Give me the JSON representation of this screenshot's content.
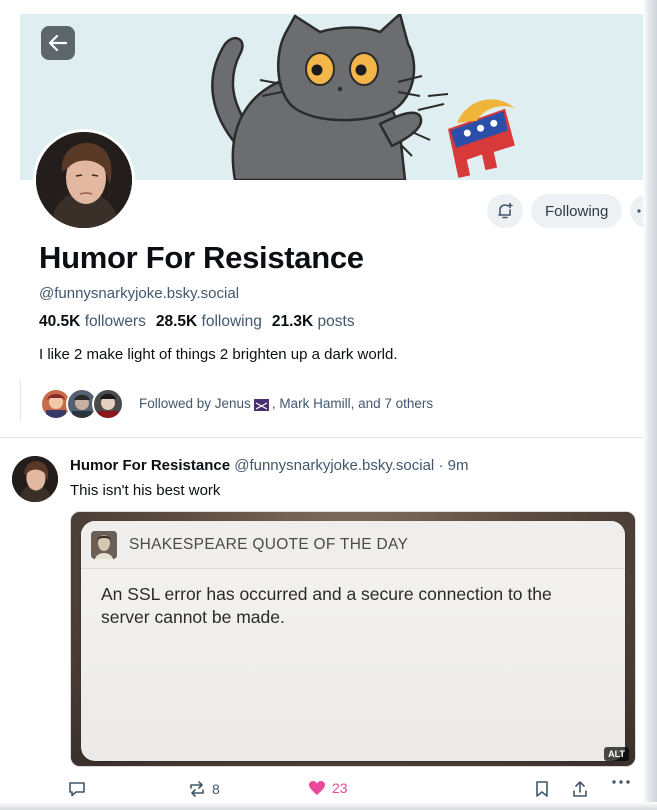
{
  "profile": {
    "display_name": "Humor For Resistance",
    "handle": "@funnysnarkyjoke.bsky.social",
    "bio": "I like 2 make light of things 2 brighten up a dark world.",
    "stats": {
      "followers_count": "40.5K",
      "followers_label": "followers",
      "following_count": "28.5K",
      "following_label": "following",
      "posts_count": "21.3K",
      "posts_label": "posts"
    },
    "following_button_label": "Following",
    "followed_by": {
      "prefix": "Followed by Jenus",
      "suffix": ", Mark Hamill, and 7 others"
    }
  },
  "post": {
    "author_name": "Humor For Resistance",
    "author_handle": "@funnysnarkyjoke.bsky.social",
    "separator": "·",
    "time": "9m",
    "text": "This isn't his best work",
    "image": {
      "card_title": "SHAKESPEARE QUOTE OF THE DAY",
      "card_body": "An SSL error has occurred and a secure connection to the server cannot be made.",
      "alt_badge": "ALT"
    },
    "actions": {
      "reply_icon": "reply-icon",
      "repost_count": "8",
      "like_count": "23",
      "bookmark_icon": "bookmark-icon",
      "share_icon": "share-icon",
      "more_icon": "more-icon"
    }
  },
  "colors": {
    "banner_bg": "#dfeef0",
    "like_pink": "#ec4899",
    "muted_text": "#42576c",
    "button_bg": "#eef1f4"
  }
}
